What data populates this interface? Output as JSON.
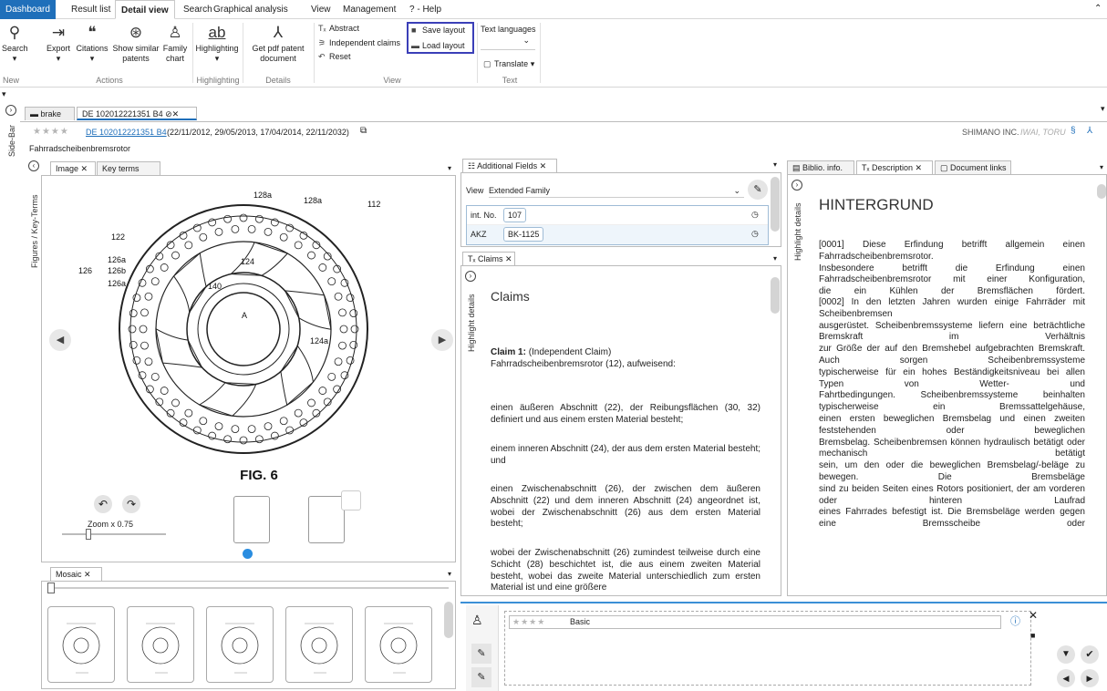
{
  "menu": {
    "tabs": [
      "Dashboard",
      "Result list",
      "Detail view",
      "Search",
      "Graphical analysis",
      "View",
      "Management",
      "? - Help"
    ]
  },
  "ribbon": {
    "buttons": [
      {
        "label": "Search",
        "icon": "search-icon",
        "glyph": "⚲"
      },
      {
        "label": "Export",
        "icon": "export-icon",
        "glyph": "⇥"
      },
      {
        "label": "Citations",
        "icon": "citations-icon",
        "glyph": "❝"
      },
      {
        "label": "Show similar patents",
        "icon": "similar-patents-icon",
        "glyph": "⊛"
      },
      {
        "label": "Family chart",
        "icon": "family-chart-icon",
        "glyph": "♙"
      },
      {
        "label": "Highlighting",
        "icon": "highlighting-icon",
        "glyph": "ab"
      },
      {
        "label": "Get pdf patent document",
        "icon": "pdf-icon",
        "glyph": "⅄"
      }
    ],
    "groups": [
      "New",
      "Actions",
      "Highlighting",
      "Details",
      "View",
      "Text"
    ],
    "view_items": [
      "Abstract",
      "Independent claims",
      "Reset"
    ],
    "layout_items": [
      "Save layout",
      "Load layout"
    ],
    "text_languages_label": "Text languages",
    "translate_label": "Translate"
  },
  "doc_tabs": [
    "brake",
    "DE 102012221351 B4"
  ],
  "side_bar_label": "Side-Bar",
  "header": {
    "stars": "★★★★",
    "patent_number": "DE 102012221351 B4",
    "dates": "(22/11/2012, 29/05/2013, 17/04/2014, 22/11/2032)",
    "applicant": "SHIMANO INC.",
    "inventor": "IWAI, TORU",
    "title": "Fahrradscheibenbremsrotor"
  },
  "figures": {
    "side_label": "Figures / Key-Terms",
    "tabs": [
      "Image",
      "Key terms"
    ],
    "fig_label": "FIG. 6",
    "zoom_label": "Zoom x 0.75",
    "zoom_level": 0.25,
    "callouts": [
      "128a",
      "128a",
      "112",
      "122",
      "126a",
      "126",
      "126b",
      "126a",
      "124",
      "140",
      "A",
      "124a"
    ]
  },
  "mosaic": {
    "tab": "Mosaic",
    "count": 5
  },
  "additional_fields": {
    "tab": "Additional Fields",
    "view_label": "View",
    "view_value": "Extended Family",
    "rows": [
      {
        "key": "int. No.",
        "value": "107"
      },
      {
        "key": "AKZ",
        "value": "BK-1125"
      }
    ]
  },
  "claims": {
    "tab": "Claims",
    "side_label": "Highlight details",
    "heading": "Claims",
    "claim1_label": "Claim 1:",
    "claim1_type": "(Independent Claim)",
    "claim1_text": "Fahrradscheibenbremsrotor (12), aufweisend:",
    "paragraphs": [
      "einen äußeren Abschnitt (22), der Reibungsflächen (30, 32) definiert und aus einem ersten Material besteht;",
      "einem inneren Abschnitt (24), der aus dem ersten Material besteht; und",
      "einen Zwischenabschnitt (26), der zwischen dem äußeren Abschnitt (22) und dem inneren Abschnitt (24) angeordnet ist, wobei der Zwischenabschnitt (26) aus dem ersten Material besteht;",
      "wobei der Zwischenabschnitt (26) zumindest teilweise durch eine Schicht (28) beschichtet ist, die aus einem zweiten Material besteht, wobei das zweite Material unterschiedlich zum ersten Material ist und eine größere"
    ]
  },
  "description": {
    "tabs": [
      "Biblio. info.",
      "Description",
      "Document links"
    ],
    "side_label": "Highlight details",
    "heading": "HINTERGRUND",
    "p1": [
      "[0001] Diese Erfindung betrifft allgemein einen Fahrradscheibenbremsrotor.",
      "Insbesondere betrifft die Erfindung einen Fahrradscheibenbremsrotor mit einer Konfiguration,",
      "die ein Kühlen der Bremsflächen fördert."
    ],
    "p2": [
      "[0002] In den letzten Jahren wurden einige Fahrräder mit Scheibenbremsen",
      "ausgerüstet. Scheibenbremssysteme liefern eine beträchtliche Bremskraft im Verhältnis",
      "zur Größe der auf den Bremshebel aufgebrachten Bremskraft. Auch sorgen Scheibenbremssysteme",
      "typischerweise für ein hohes Beständigkeitsniveau bei allen Typen von Wetter- und",
      "Fahrtbedingungen. Scheibenbremssysteme beinhalten typischerweise ein Bremssattelgehäuse,",
      "einen ersten beweglichen Bremsbelag und einen zweiten feststehenden oder beweglichen",
      "Bremsbelag. Scheibenbremsen können hydraulisch betätigt oder mechanisch betätigt",
      "sein, um den oder die beweglichen Bremsbelag/-beläge zu bewegen. Die Bremsbeläge",
      "sind zu beiden Seiten eines Rotors positioniert, der am vorderen oder hinteren Laufrad",
      "eines Fahrrades befestigt ist. Die Bremsbeläge werden gegen eine Bremsscheibe oder"
    ]
  },
  "notes": {
    "stars": "★★★★",
    "rating_label": "Basic"
  },
  "colors": {
    "accent": "#1f6fba",
    "highlight_box": "#3b3fb8",
    "link": "#1f6fba"
  }
}
